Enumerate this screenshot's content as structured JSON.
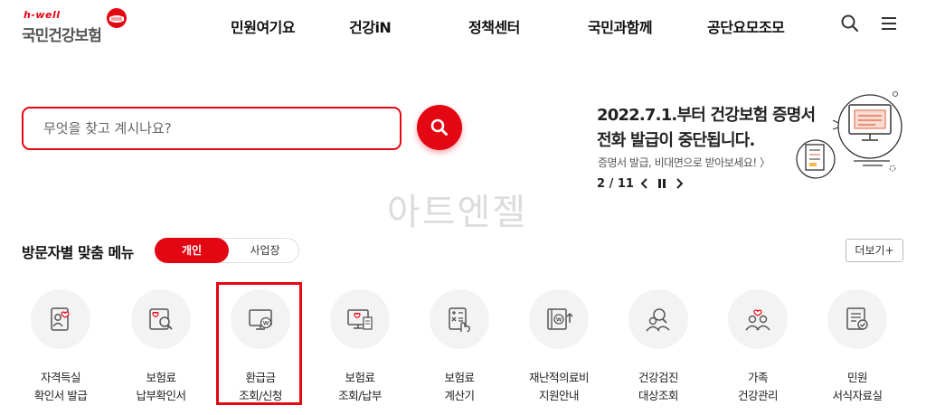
{
  "logo": {
    "tagline": "h-well",
    "name": "국민건강보험"
  },
  "nav": [
    {
      "label": "민원여기요"
    },
    {
      "label": "건강iN"
    },
    {
      "label": "정책센터"
    },
    {
      "label": "국민과함께"
    },
    {
      "label": "공단요모조모"
    }
  ],
  "header_icons": [
    "search-icon",
    "hamburger-menu-icon"
  ],
  "search": {
    "placeholder": "무엇을 찾고 계시나요?",
    "value": ""
  },
  "notice": {
    "line1": "2022.7.1.부터 건강보험 증명서",
    "line2": "전화 발급이 중단됩니다.",
    "sub": "증명서 발급, 비대면으로 받아보세요! 〉",
    "page_current": "2",
    "page_total": "11",
    "pager_text": "2 / 11"
  },
  "watermark": "아트엔젤",
  "menu": {
    "title": "방문자별 맞춤 메뉴",
    "toggle_active": "개인",
    "toggle_inactive": "사업장",
    "more": "더보기+",
    "items": [
      {
        "line1": "자격득실",
        "line2": "확인서 발급",
        "icon": "profile-card-heart-icon"
      },
      {
        "line1": "보험료",
        "line2": "납부확인서",
        "icon": "document-search-icon"
      },
      {
        "line1": "환급금",
        "line2": "조회/신청",
        "icon": "monitor-won-icon",
        "highlighted": true
      },
      {
        "line1": "보험료",
        "line2": "조회/납부",
        "icon": "monitor-receipt-icon"
      },
      {
        "line1": "보험료",
        "line2": "계산기",
        "icon": "calculator-hand-icon"
      },
      {
        "line1": "재난적의료비",
        "line2": "지원안내",
        "icon": "book-won-icon"
      },
      {
        "line1": "건강검진",
        "line2": "대상조회",
        "icon": "person-search-icon"
      },
      {
        "line1": "가족",
        "line2": "건강관리",
        "icon": "family-heart-icon"
      },
      {
        "line1": "민원",
        "line2": "서식자료실",
        "icon": "form-check-icon"
      }
    ]
  },
  "colors": {
    "brand_red": "#e30613",
    "icon_gray": "#555555",
    "circle_bg": "#f3f3f3"
  }
}
